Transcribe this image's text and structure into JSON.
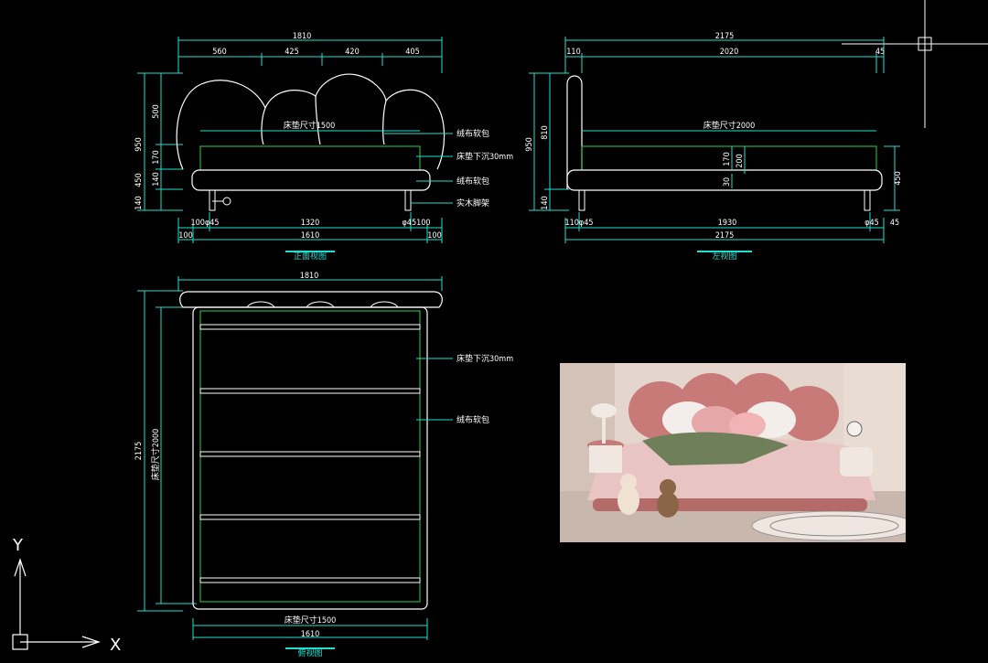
{
  "front": {
    "width_total": "1810",
    "seg": [
      "560",
      "425",
      "420",
      "405"
    ],
    "h_total": "950",
    "h_500": "500",
    "h_170": "170",
    "h_450": "450",
    "h_140a": "140",
    "h_140b": "140",
    "mattress": "床垫尺寸1500",
    "label_fabric_top": "绒布软包",
    "label_sink": "床垫下沉30mm",
    "label_fabric_base": "绒布软包",
    "label_wood": "实木脚架",
    "bot_left": "100φ45",
    "bot_mid": "1320",
    "bot_right": "φ45100",
    "b2_left": "100",
    "b2_mid": "1610",
    "b2_right": "100",
    "title": "正面视图"
  },
  "side": {
    "total": "2175",
    "seg_left": "110",
    "seg_mid": "2020",
    "seg_right": "45",
    "h_950": "950",
    "h_810": "810",
    "h_140": "140",
    "h_170": "170",
    "h_200": "200",
    "h_30": "30",
    "h_450": "450",
    "mattress": "床垫尺寸2000",
    "bot_left": "110φ45",
    "bot_mid": "1930",
    "bot_right": "φ45",
    "bot_end": "45",
    "b2": "2175",
    "title": "左视图"
  },
  "top": {
    "width": "1810",
    "length": "2175",
    "mattress_len": "床垫尺寸2000",
    "label_sink": "床垫下沉30mm",
    "label_fabric": "绒布软包",
    "mattress_w": "床垫尺寸1500",
    "bottom": "1610",
    "title": "俯视图"
  },
  "axes": {
    "y": "Y",
    "x": "X"
  },
  "colors": {
    "cyan": "#22e0d0",
    "white": "#ffffff",
    "green": "#2bd14a"
  }
}
